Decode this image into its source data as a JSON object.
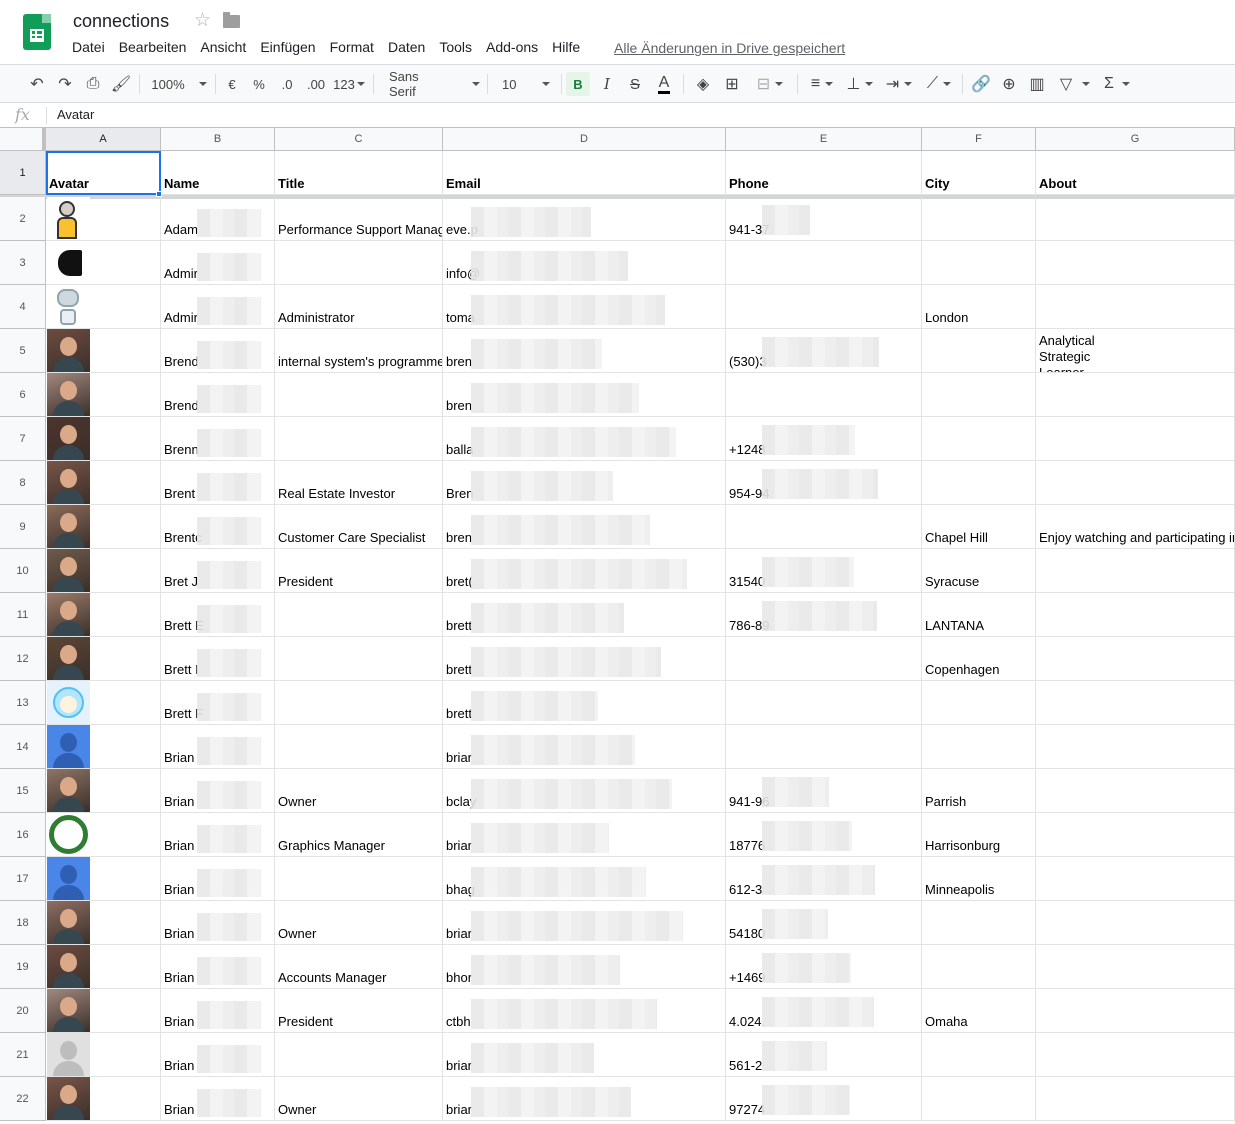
{
  "app": {
    "doc_title": "connections",
    "saved_status": "Alle Änderungen in Drive gespeichert",
    "menu": [
      "Datei",
      "Bearbeiten",
      "Ansicht",
      "Einfügen",
      "Format",
      "Daten",
      "Tools",
      "Add-ons",
      "Hilfe"
    ]
  },
  "toolbar": {
    "zoom": "100%",
    "currency": "€",
    "percent": "%",
    "decimal_less": ".0",
    "decimal_more": ".00",
    "number_format": "123",
    "font": "Sans Serif",
    "font_size": "10",
    "bold": "B",
    "italic": "I",
    "strike": "S",
    "text_color": "A"
  },
  "formula": {
    "fx": "fx",
    "value": "Avatar"
  },
  "columns": [
    "A",
    "B",
    "C",
    "D",
    "E",
    "F",
    "G"
  ],
  "header_row": [
    "Avatar",
    "Name",
    "Title",
    "Email",
    "Phone",
    "City",
    "About"
  ],
  "rows": [
    {
      "n": "2",
      "name": "Adam",
      "title": "Performance Support Manager",
      "email": "eve.p",
      "phone": "941-37",
      "city": "",
      "about": "",
      "avatar": "cartoon-figure"
    },
    {
      "n": "3",
      "name": "Admir",
      "title": "",
      "email": "info@",
      "phone": "",
      "city": "",
      "about": "",
      "avatar": "logo-dark"
    },
    {
      "n": "4",
      "name": "Admir",
      "title": "Administrator",
      "email": "toma",
      "phone": "",
      "city": "London",
      "about": "",
      "avatar": "robot"
    },
    {
      "n": "5",
      "name": "Brend",
      "title": "internal system's programmer",
      "email": "bren",
      "phone": "(530)3",
      "city": "",
      "about": "Analytical\nStrategic\nLearner",
      "avatar": "photo"
    },
    {
      "n": "6",
      "name": "Brend",
      "title": "",
      "email": "bren",
      "phone": "",
      "city": "",
      "about": "",
      "avatar": "photo"
    },
    {
      "n": "7",
      "name": "Brenn",
      "title": "",
      "email": "balla",
      "phone": "+1248",
      "city": "",
      "about": "",
      "avatar": "photo"
    },
    {
      "n": "8",
      "name": "Brent",
      "title": "Real Estate Investor",
      "email": "Bren",
      "phone": "954-94",
      "city": "",
      "about": "",
      "avatar": "photo"
    },
    {
      "n": "9",
      "name": "Brentc",
      "title": "Customer Care Specialist",
      "email": "bren",
      "phone": "",
      "city": "Chapel Hill",
      "about": "Enjoy watching and participating in c",
      "avatar": "photo"
    },
    {
      "n": "10",
      "name": "Bret J",
      "title": "President",
      "email": "bret(",
      "phone": "31540",
      "city": "Syracuse",
      "about": "",
      "avatar": "photo"
    },
    {
      "n": "11",
      "name": "Brett E",
      "title": "",
      "email": "brett",
      "phone": "786-89",
      "city": "LANTANA",
      "about": "",
      "avatar": "photo"
    },
    {
      "n": "12",
      "name": "Brett I",
      "title": "",
      "email": "brett",
      "phone": "",
      "city": "Copenhagen",
      "about": "",
      "avatar": "photo"
    },
    {
      "n": "13",
      "name": "Brett F",
      "title": "",
      "email": "brett",
      "phone": "",
      "city": "",
      "about": "",
      "avatar": "cartoon-face"
    },
    {
      "n": "14",
      "name": "Brian",
      "title": "",
      "email": "briar",
      "phone": "",
      "city": "",
      "about": "",
      "avatar": "default"
    },
    {
      "n": "15",
      "name": "Brian",
      "title": "Owner",
      "email": "bclay",
      "phone": "941-96",
      "city": "Parrish",
      "about": "",
      "avatar": "photo"
    },
    {
      "n": "16",
      "name": "Brian",
      "title": "Graphics Manager",
      "email": "briar",
      "phone": "18776",
      "city": "Harrisonburg",
      "about": "",
      "avatar": "ring-logo"
    },
    {
      "n": "17",
      "name": "Brian",
      "title": "",
      "email": "bhag",
      "phone": "612-3",
      "city": "Minneapolis",
      "about": "",
      "avatar": "default"
    },
    {
      "n": "18",
      "name": "Brian",
      "title": "Owner",
      "email": "briar",
      "phone": "54180",
      "city": "",
      "about": "",
      "avatar": "photo"
    },
    {
      "n": "19",
      "name": "Brian",
      "title": "Accounts Manager",
      "email": "bhor",
      "phone": "+1469",
      "city": "",
      "about": "",
      "avatar": "photo"
    },
    {
      "n": "20",
      "name": "Brian",
      "title": "President",
      "email": "ctbh",
      "phone": "4.024.",
      "city": "Omaha",
      "about": "",
      "avatar": "photo"
    },
    {
      "n": "21",
      "name": "Brian",
      "title": "",
      "email": "briar",
      "phone": "561-2",
      "city": "",
      "about": "",
      "avatar": "silhouette"
    },
    {
      "n": "22",
      "name": "Brian",
      "title": "Owner",
      "email": "briar",
      "phone": "97274",
      "city": "",
      "about": "",
      "avatar": "photo"
    }
  ],
  "colors": {
    "selection": "#1a73e8",
    "sheets_green": "#0f9d58",
    "default_avatar": "#4a86e8"
  }
}
